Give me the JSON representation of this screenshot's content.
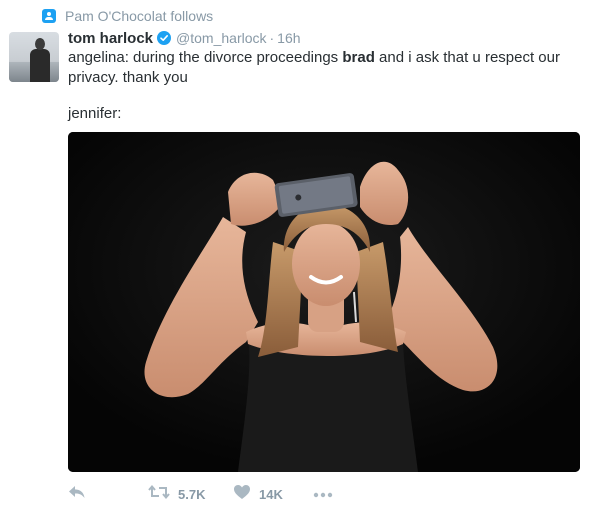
{
  "context": {
    "icon": "follow-icon",
    "text": "Pam O'Chocolat follows"
  },
  "author": {
    "name": "tom harlock",
    "handle": "@tom_harlock",
    "separator": "·",
    "time": "16h",
    "verified_icon": "verified-badge-icon",
    "avatar": "avatar-image"
  },
  "text": {
    "part1": "angelina: during the divorce proceedings ",
    "bold": "brad",
    "part2": " and i ask that u respect our privacy. thank you",
    "line2": "jennifer:"
  },
  "media": {
    "icon": "photo-woman-taking-selfie"
  },
  "actions": {
    "reply_icon": "reply-icon",
    "retweet_icon": "retweet-icon",
    "retweet_count": "5.7K",
    "like_icon": "heart-icon",
    "like_count": "14K",
    "more_icon": "more-icon"
  },
  "colors": {
    "accent": "#1da1f2",
    "muted": "#8899a6",
    "text": "#292f33",
    "icon": "#aab8c2"
  }
}
